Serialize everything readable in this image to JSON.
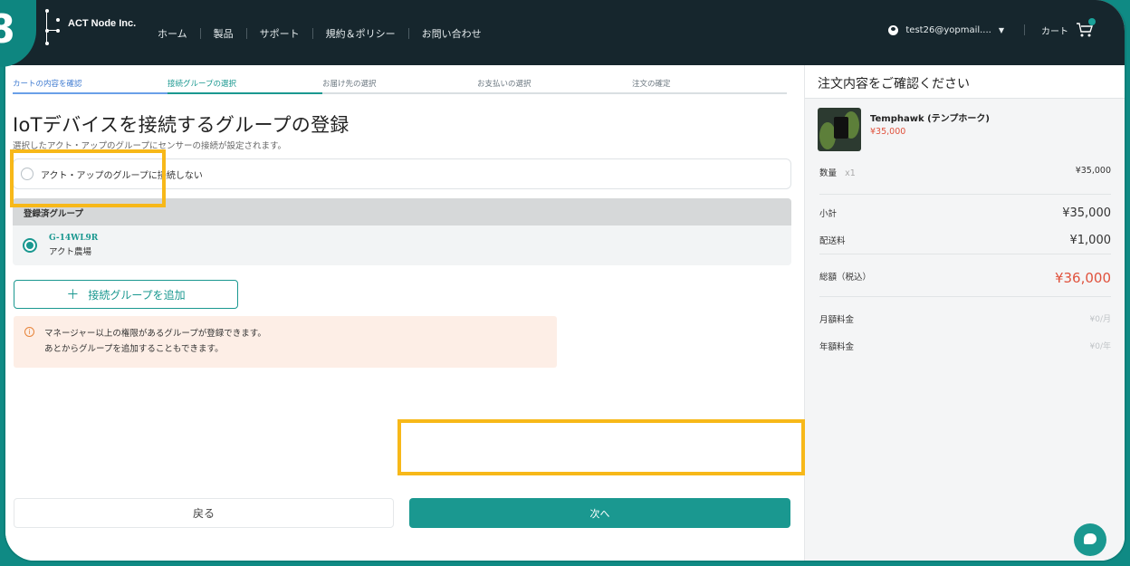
{
  "step_badge": "8",
  "header": {
    "logo_text": "ACT Node Inc.",
    "nav": [
      "ホーム",
      "製品",
      "サポート",
      "規約＆ポリシー",
      "お問い合わせ"
    ],
    "user_email": "test26@yopmail....",
    "cart_label": "カート"
  },
  "steps": [
    {
      "label": "カートの内容を確認",
      "state": "done"
    },
    {
      "label": "接続グループの選択",
      "state": "active"
    },
    {
      "label": "お届け先の選択",
      "state": "pending"
    },
    {
      "label": "お支払いの選択",
      "state": "pending"
    },
    {
      "label": "注文の確定",
      "state": "pending"
    }
  ],
  "main": {
    "title": "IoTデバイスを接続するグループの登録",
    "subtitle": "選択したアクト・アップのグループにセンサーの接続が設定されます。",
    "no_group_option": "アクト・アップのグループに接続しない",
    "registered_header": "登録済グループ",
    "group": {
      "code": "G-14WL9R",
      "name": "アクト農場"
    },
    "add_group_label": "接続グループを追加",
    "notice_lines": [
      "マネージャー以上の権限があるグループが登録できます。",
      "あとからグループを追加することもできます。"
    ],
    "back_label": "戻る",
    "next_label": "次へ"
  },
  "summary": {
    "title": "注文内容をご確認ください",
    "product_name": "Temphawk (テンプホーク)",
    "product_price": "¥35,000",
    "qty_label": "数量",
    "qty_value": "x1",
    "qty_total": "¥35,000",
    "subtotal_label": "小計",
    "subtotal_value": "¥35,000",
    "shipping_label": "配送料",
    "shipping_value": "¥1,000",
    "total_label": "総額（税込）",
    "total_value": "¥36,000",
    "monthly_label": "月額料金",
    "monthly_value": "¥0/月",
    "yearly_label": "年額料金",
    "yearly_value": "¥0/年"
  },
  "colors": {
    "accent": "#1a9890",
    "header_bg": "#16262d",
    "highlight": "#f7b819",
    "price": "#e0523d"
  }
}
